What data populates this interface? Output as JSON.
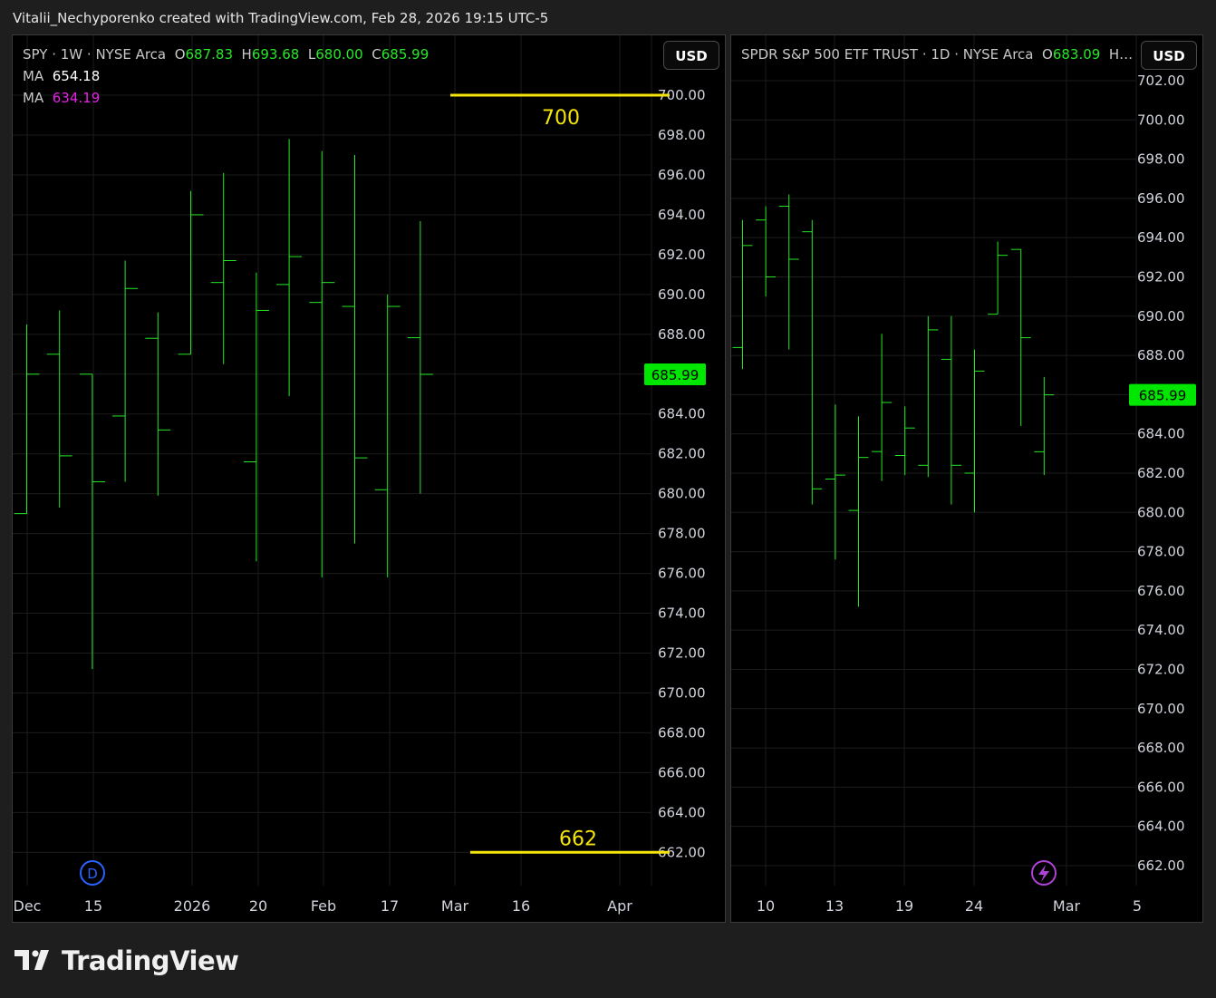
{
  "header": {
    "title": "Vitalii_Nechyporenko created with TradingView.com, Feb 28, 2026 19:15 UTC-5"
  },
  "brand": {
    "name": "TradingView"
  },
  "colors": {
    "up": "#26e826",
    "ma1": "#ffffff",
    "ma2": "#e620e6",
    "annotation": "#f5e50a",
    "price_tag_bg": "#00e600",
    "grid": "#1c1c1c"
  },
  "left_chart": {
    "legend": {
      "symbol": "SPY",
      "interval": "1W",
      "exchange": "NYSE Arca",
      "o_label": "O",
      "o": "687.83",
      "h_label": "H",
      "h": "693.68",
      "l_label": "L",
      "l": "680.00",
      "c_label": "C",
      "c": "685.99"
    },
    "ma1": {
      "label": "MA",
      "value": "654.18"
    },
    "ma2": {
      "label": "MA",
      "value": "634.19"
    },
    "currency": "USD",
    "last_price": "685.99",
    "event_badge": "D",
    "annotations": [
      {
        "text": "700",
        "price": 700
      },
      {
        "text": "662",
        "price": 662
      }
    ]
  },
  "right_chart": {
    "legend": {
      "name": "SPDR S&P 500 ETF TRUST",
      "interval": "1D",
      "exchange": "NYSE Arca",
      "o_label": "O",
      "o": "683.09",
      "rest": "H…"
    },
    "currency": "USD",
    "last_price": "685.99",
    "event_icon": "lightning-icon"
  },
  "chart_data": [
    {
      "type": "ohlc",
      "title": "SPY · 1W · NYSE Arca",
      "ylim": [
        660,
        702
      ],
      "y_ticks": [
        "700.00",
        "698.00",
        "696.00",
        "694.00",
        "692.00",
        "690.00",
        "688.00",
        "686.00",
        "684.00",
        "682.00",
        "680.00",
        "678.00",
        "676.00",
        "674.00",
        "672.00",
        "670.00",
        "668.00",
        "666.00",
        "664.00",
        "662.00"
      ],
      "x_ticks": [
        "Dec",
        "15",
        "2026",
        "20",
        "Feb",
        "17",
        "Mar",
        "16",
        "Apr"
      ],
      "bars": [
        {
          "o": 679.0,
          "h": 688.5,
          "l": 679.0,
          "c": 686.0
        },
        {
          "o": 687.0,
          "h": 689.2,
          "l": 679.3,
          "c": 681.9
        },
        {
          "o": 686.0,
          "h": 686.0,
          "l": 671.2,
          "c": 680.6
        },
        {
          "o": 683.9,
          "h": 691.7,
          "l": 680.6,
          "c": 690.3
        },
        {
          "o": 687.8,
          "h": 689.1,
          "l": 679.9,
          "c": 683.2
        },
        {
          "o": 687.0,
          "h": 695.2,
          "l": 687.0,
          "c": 694.0
        },
        {
          "o": 690.6,
          "h": 696.1,
          "l": 686.5,
          "c": 691.7
        },
        {
          "o": 681.6,
          "h": 691.1,
          "l": 676.6,
          "c": 689.2
        },
        {
          "o": 690.5,
          "h": 697.8,
          "l": 684.9,
          "c": 691.9
        },
        {
          "o": 689.6,
          "h": 697.2,
          "l": 675.8,
          "c": 690.6
        },
        {
          "o": 689.4,
          "h": 697.0,
          "l": 677.5,
          "c": 681.8
        },
        {
          "o": 680.2,
          "h": 690.0,
          "l": 675.8,
          "c": 689.4
        },
        {
          "o": 687.83,
          "h": 693.68,
          "l": 680.0,
          "c": 685.99
        }
      ]
    },
    {
      "type": "ohlc",
      "title": "SPDR S&P 500 ETF TRUST · 1D · NYSE Arca",
      "ylim": [
        660,
        703.5
      ],
      "y_ticks": [
        "702.00",
        "700.00",
        "698.00",
        "696.00",
        "694.00",
        "692.00",
        "690.00",
        "688.00",
        "686.00",
        "684.00",
        "682.00",
        "680.00",
        "678.00",
        "676.00",
        "674.00",
        "672.00",
        "670.00",
        "668.00",
        "666.00",
        "664.00",
        "662.00"
      ],
      "x_ticks": [
        "10",
        "13",
        "19",
        "24",
        "Mar",
        "5"
      ],
      "bars": [
        {
          "o": 688.4,
          "h": 694.9,
          "l": 687.3,
          "c": 693.6
        },
        {
          "o": 694.9,
          "h": 695.6,
          "l": 691.0,
          "c": 692.0
        },
        {
          "o": 695.6,
          "h": 696.2,
          "l": 688.3,
          "c": 692.9
        },
        {
          "o": 694.3,
          "h": 694.9,
          "l": 680.4,
          "c": 681.2
        },
        {
          "o": 681.7,
          "h": 685.5,
          "l": 677.6,
          "c": 681.9
        },
        {
          "o": 680.1,
          "h": 684.9,
          "l": 675.2,
          "c": 682.8
        },
        {
          "o": 683.1,
          "h": 689.1,
          "l": 681.6,
          "c": 685.6
        },
        {
          "o": 682.9,
          "h": 685.4,
          "l": 681.9,
          "c": 684.3
        },
        {
          "o": 682.4,
          "h": 690.0,
          "l": 681.8,
          "c": 689.3
        },
        {
          "o": 687.8,
          "h": 690.0,
          "l": 680.4,
          "c": 682.4
        },
        {
          "o": 682.0,
          "h": 688.3,
          "l": 680.0,
          "c": 687.2
        },
        {
          "o": 690.1,
          "h": 693.8,
          "l": 690.1,
          "c": 693.1
        },
        {
          "o": 693.4,
          "h": 693.4,
          "l": 684.4,
          "c": 688.9
        },
        {
          "o": 683.09,
          "h": 686.9,
          "l": 681.9,
          "c": 685.99
        }
      ]
    }
  ]
}
